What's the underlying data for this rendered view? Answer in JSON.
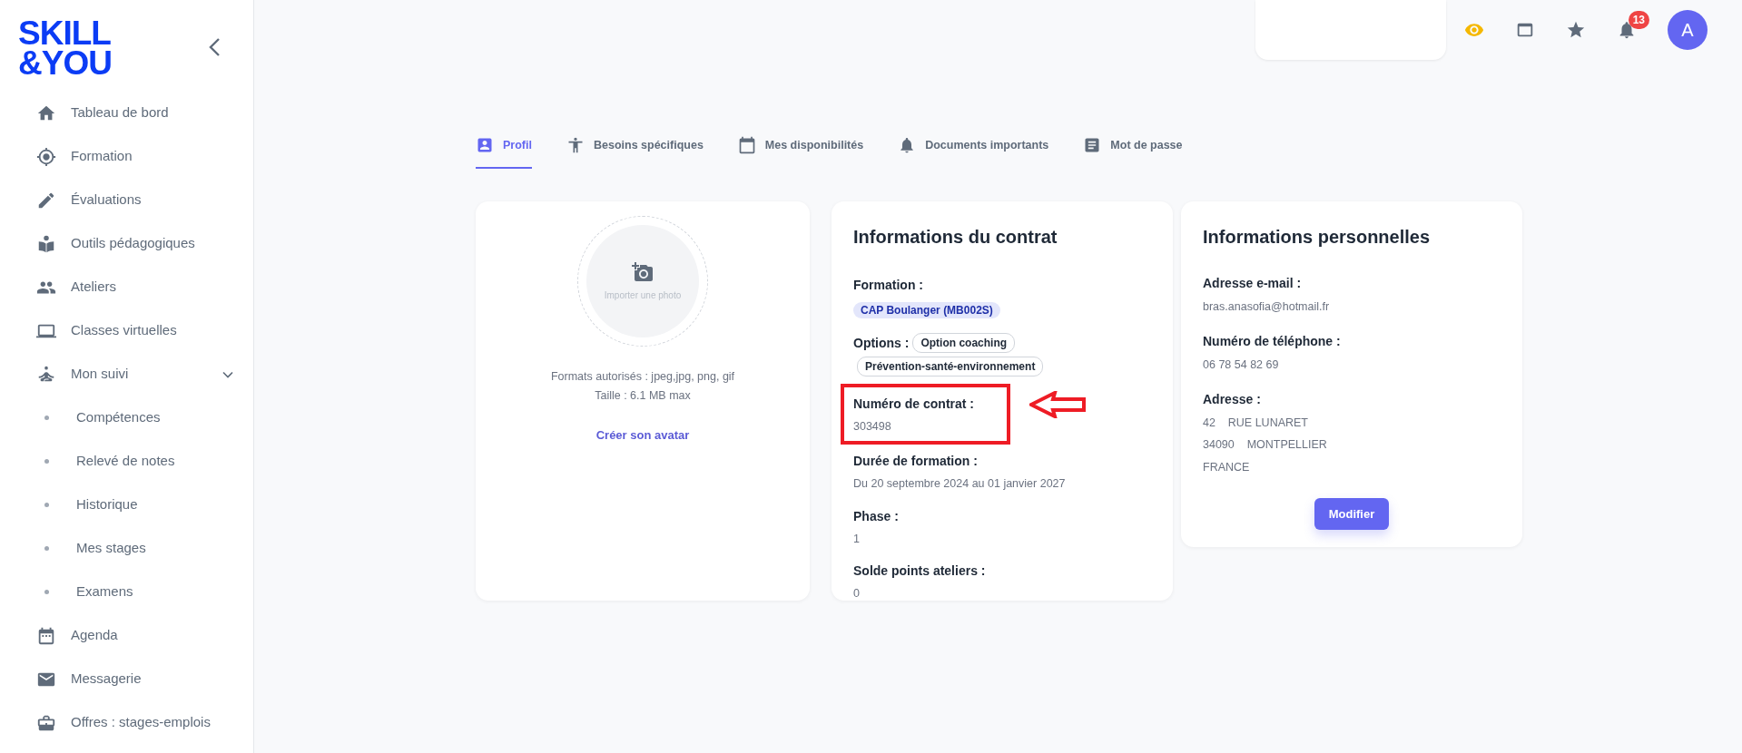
{
  "logo": {
    "line_1": "SKILL",
    "line_2": "&YOU"
  },
  "sidebar": {
    "items": [
      {
        "label": "Tableau de bord"
      },
      {
        "label": "Formation"
      },
      {
        "label": "Évaluations"
      },
      {
        "label": "Outils pédagogiques"
      },
      {
        "label": "Ateliers"
      },
      {
        "label": "Classes virtuelles"
      },
      {
        "label": "Mon suivi",
        "expanded": true,
        "children": [
          {
            "label": "Compétences"
          },
          {
            "label": "Relevé de notes"
          },
          {
            "label": "Historique"
          },
          {
            "label": "Mes stages"
          },
          {
            "label": "Examens"
          }
        ]
      },
      {
        "label": "Agenda"
      },
      {
        "label": "Messagerie"
      },
      {
        "label": "Offres : stages-emplois"
      }
    ]
  },
  "topbar": {
    "notification_count": "13",
    "avatar_initial": "A"
  },
  "tabs": [
    {
      "label": "Profil",
      "selected": true
    },
    {
      "label": "Besoins spécifiques",
      "selected": false
    },
    {
      "label": "Mes disponibilités",
      "selected": false
    },
    {
      "label": "Documents importants",
      "selected": false
    },
    {
      "label": "Mot de passe",
      "selected": false
    }
  ],
  "photo_card": {
    "upload_label": "Importer une photo",
    "formats": "Formats autorisés : jpeg,jpg, png, gif",
    "size": "Taille : 6.1 MB max",
    "avatar_link": "Créer son avatar"
  },
  "contract_card": {
    "title": "Informations du contrat",
    "fields": [
      {
        "label": "Formation :",
        "kind": "badge",
        "values": [
          "CAP Boulanger (MB002S)"
        ],
        "highlighted": false
      },
      {
        "label": "Options :",
        "kind": "tags",
        "values": [
          "Option coaching",
          "Prévention-santé-environnement"
        ],
        "highlighted": false
      },
      {
        "label": "Numéro de contrat :",
        "kind": "text",
        "values": [
          "303498"
        ],
        "highlighted": true
      },
      {
        "label": "Durée de formation :",
        "kind": "text",
        "values": [
          "Du 20 septembre 2024 au 01 janvier 2027"
        ],
        "highlighted": false
      },
      {
        "label": "Phase :",
        "kind": "text",
        "values": [
          "1"
        ],
        "highlighted": false
      },
      {
        "label": "Solde points ateliers :",
        "kind": "text",
        "values": [
          "0"
        ],
        "highlighted": false
      }
    ]
  },
  "personal_card": {
    "title": "Informations personnelles",
    "fields": [
      {
        "label": "Adresse e-mail :",
        "values": [
          "bras.anasofia@hotmail.fr"
        ]
      },
      {
        "label": "Numéro de téléphone :",
        "values": [
          "06 78 54 82 69"
        ]
      },
      {
        "label": "Adresse :",
        "values": [
          "42    RUE LUNARET",
          "34090    MONTPELLIER",
          "FRANCE"
        ]
      }
    ],
    "button": "Modifier"
  }
}
